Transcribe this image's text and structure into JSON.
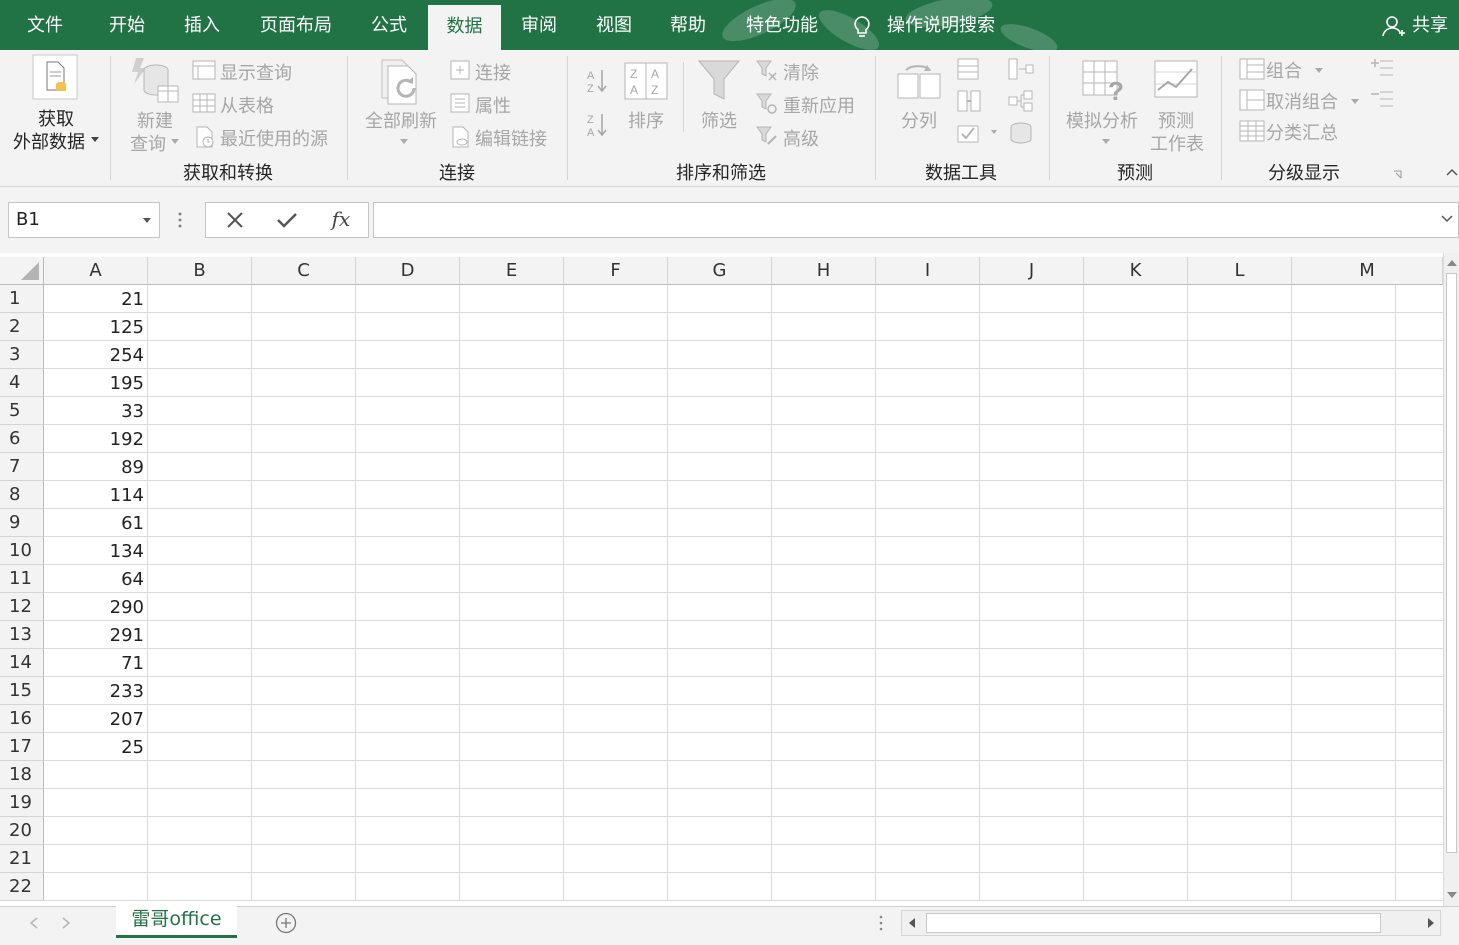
{
  "colors": {
    "brand": "#217346",
    "ribbon_bg": "#f3f3f3",
    "disabled_text": "#a6a6a6"
  },
  "menu": {
    "tabs": [
      "文件",
      "开始",
      "插入",
      "页面布局",
      "公式",
      "数据",
      "审阅",
      "视图",
      "帮助",
      "特色功能"
    ],
    "active_tab": "数据",
    "tell_me": "操作说明搜索",
    "share": "共享"
  },
  "ribbon": {
    "get_data": {
      "line1": "获取",
      "line2": "外部数据"
    },
    "get_transform": {
      "new_query": {
        "line1": "新建",
        "line2": "查询"
      },
      "show_queries": "显示查询",
      "from_table": "从表格",
      "recent_sources": "最近使用的源",
      "label": "获取和转换"
    },
    "connections": {
      "refresh_all": "全部刷新",
      "connections": "连接",
      "properties": "属性",
      "edit_links": "编辑链接",
      "label": "连接"
    },
    "sort_filter": {
      "sort": "排序",
      "filter": "筛选",
      "clear": "清除",
      "reapply": "重新应用",
      "advanced": "高级",
      "label": "排序和筛选"
    },
    "data_tools": {
      "text_to_columns": "分列",
      "label": "数据工具"
    },
    "forecast": {
      "what_if": "模拟分析",
      "forecast_sheet": {
        "line1": "预测",
        "line2": "工作表"
      },
      "label": "预测"
    },
    "outline": {
      "group": "组合",
      "ungroup": "取消组合",
      "subtotal": "分类汇总",
      "label": "分级显示"
    }
  },
  "formula_bar": {
    "name_box": "B1",
    "fx": "fx",
    "content": ""
  },
  "grid": {
    "columns": [
      "A",
      "B",
      "C",
      "D",
      "E",
      "F",
      "G",
      "H",
      "I",
      "J",
      "K",
      "L",
      "M"
    ],
    "rows": [
      "1",
      "2",
      "3",
      "4",
      "5",
      "6",
      "7",
      "8",
      "9",
      "10",
      "11",
      "12",
      "13",
      "14",
      "15",
      "16",
      "17",
      "18",
      "19",
      "20",
      "21",
      "22"
    ],
    "column_a_values": [
      "21",
      "125",
      "254",
      "195",
      "33",
      "192",
      "89",
      "114",
      "61",
      "134",
      "64",
      "290",
      "291",
      "71",
      "233",
      "207",
      "25"
    ]
  },
  "sheets": {
    "active": "雷哥office"
  }
}
